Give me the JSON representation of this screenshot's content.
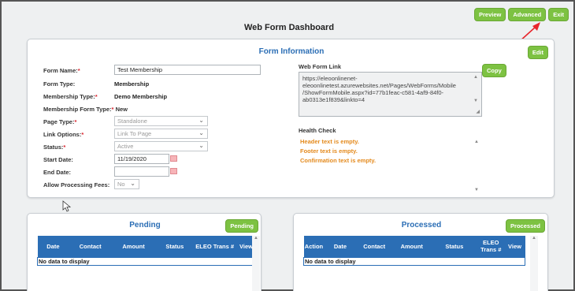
{
  "header": {
    "title": "Web Form Dashboard",
    "buttons": {
      "preview": "Preview",
      "advanced": "Advanced",
      "exit": "Exit"
    }
  },
  "form_info": {
    "title": "Form Information",
    "edit": "Edit",
    "fields": {
      "form_name": {
        "label": "Form Name:",
        "req": "*",
        "value": "Test Membership"
      },
      "form_type": {
        "label": "Form Type:",
        "value": "Membership"
      },
      "membership_type": {
        "label": "Membership Type:",
        "req": "*",
        "value": "Demo Membership"
      },
      "membership_form_type": {
        "label": "Membership Form Type:",
        "req": "*",
        "value": "New"
      },
      "page_type": {
        "label": "Page Type:",
        "req": "*",
        "value": "Standalone"
      },
      "link_options": {
        "label": "Link Options:",
        "req": "*",
        "value": "Link To Page"
      },
      "status": {
        "label": "Status:",
        "req": "*",
        "value": "Active"
      },
      "start_date": {
        "label": "Start Date:",
        "value": "11/19/2020"
      },
      "end_date": {
        "label": "End Date:",
        "value": ""
      },
      "allow_fees": {
        "label": "Allow Processing Fees:",
        "value": "No"
      }
    },
    "web_form_link": {
      "label": "Web Form Link",
      "copy": "Copy",
      "lines": [
        "https://eleoonlinenet-",
        "eleoonlinetest.azurewebsites.net/Pages/WebForms/Mobile",
        "/ShowFormMobile.aspx?id=77b1feac-c581-4af9-84f0-",
        "ab0313e1f839&linkto=4"
      ]
    },
    "health_check": {
      "label": "Health Check",
      "messages": [
        "Header text is empty.",
        "Footer text is empty.",
        "Confirmation text is empty."
      ]
    }
  },
  "pending": {
    "title": "Pending",
    "button": "Pending",
    "columns": [
      "Date",
      "Contact",
      "Amount",
      "Status",
      "ELEO Trans #",
      "View"
    ],
    "empty": "No data to display"
  },
  "processed": {
    "title": "Processed",
    "button": "Processed",
    "columns": [
      "Action",
      "Date",
      "Contact",
      "Amount",
      "Status",
      "ELEO Trans #",
      "View"
    ],
    "empty": "No data to display"
  },
  "colors": {
    "accent": "#2b6eb5",
    "green": "#7dc242",
    "required": "#d9232d",
    "warning": "#e48a1d"
  },
  "icons": [
    "chevron-down-icon",
    "calendar-icon",
    "scroll-up-icon",
    "scroll-down-icon",
    "resize-grip-icon",
    "mouse-cursor-icon",
    "annotation-arrow-icon"
  ]
}
